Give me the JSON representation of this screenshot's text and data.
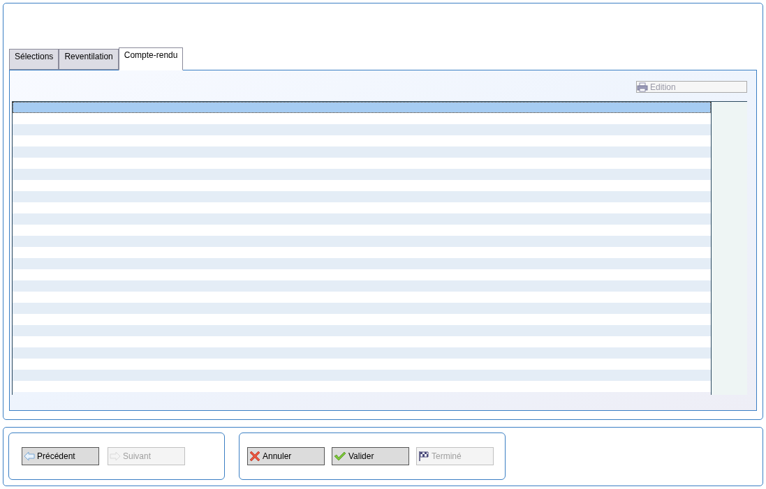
{
  "tabs": [
    {
      "label": "Sélections",
      "selected": false
    },
    {
      "label": "Reventilation",
      "selected": false
    },
    {
      "label": "Compte-rendu",
      "selected": true
    }
  ],
  "edition_button": {
    "label": "Edition",
    "disabled": true
  },
  "table": {
    "rows": [
      {
        "selected": true
      },
      {
        "selected": false
      },
      {
        "selected": false
      },
      {
        "selected": false
      },
      {
        "selected": false
      },
      {
        "selected": false
      },
      {
        "selected": false
      },
      {
        "selected": false
      },
      {
        "selected": false
      },
      {
        "selected": false
      },
      {
        "selected": false
      },
      {
        "selected": false
      },
      {
        "selected": false
      },
      {
        "selected": false
      },
      {
        "selected": false
      },
      {
        "selected": false
      },
      {
        "selected": false
      },
      {
        "selected": false
      },
      {
        "selected": false
      },
      {
        "selected": false
      },
      {
        "selected": false
      },
      {
        "selected": false
      },
      {
        "selected": false
      },
      {
        "selected": false
      },
      {
        "selected": false
      },
      {
        "selected": false
      }
    ]
  },
  "navigation_buttons": [
    {
      "label": "Précédent",
      "kind": "back",
      "disabled": false
    },
    {
      "label": "Suivant",
      "kind": "next",
      "disabled": true
    }
  ],
  "action_buttons": [
    {
      "label": "Annuler",
      "kind": "cancel",
      "disabled": false
    },
    {
      "label": "Valider",
      "kind": "confirm",
      "disabled": false
    },
    {
      "label": "Terminé",
      "kind": "finish",
      "disabled": true
    }
  ]
}
